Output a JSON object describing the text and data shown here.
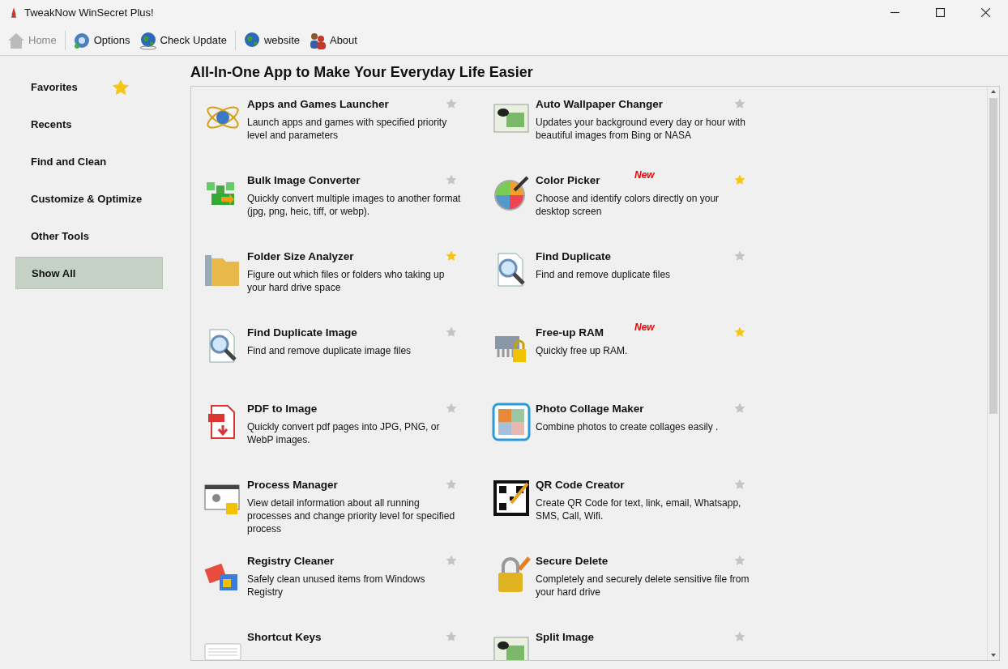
{
  "window": {
    "title": "TweakNow WinSecret Plus!"
  },
  "toolbar": [
    {
      "label": "Home",
      "disabled": true,
      "separator_after": true
    },
    {
      "label": "Options",
      "disabled": false,
      "separator_after": false
    },
    {
      "label": "Check Update",
      "disabled": false,
      "separator_after": true
    },
    {
      "label": "website",
      "disabled": false,
      "separator_after": false
    },
    {
      "label": "About",
      "disabled": false,
      "separator_after": false
    }
  ],
  "sidebar": {
    "items": [
      {
        "label": "Favorites",
        "selected": false,
        "star": true
      },
      {
        "label": "Recents",
        "selected": false,
        "star": false
      },
      {
        "label": "Find and Clean",
        "selected": false,
        "star": false
      },
      {
        "label": "Customize & Optimize",
        "selected": false,
        "star": false
      },
      {
        "label": "Other Tools",
        "selected": false,
        "star": false
      },
      {
        "label": "Show All",
        "selected": true,
        "star": false
      }
    ]
  },
  "heading": "All-In-One App to Make Your Everyday Life Easier",
  "tools": [
    {
      "title": "Apps and Games Launcher",
      "description": "Launch apps and games with specified priority level and parameters",
      "favorite": false
    },
    {
      "title": "Auto Wallpaper Changer",
      "description": "Updates your background every day or hour with beautiful images from Bing or NASA",
      "favorite": false
    },
    {
      "title": "Bulk Image Converter",
      "description": "Quickly convert multiple images to another format (jpg, png, heic, tiff, or webp).",
      "favorite": false
    },
    {
      "title": "Color Picker",
      "badge": "New",
      "description": "Choose and identify colors directly on your desktop screen",
      "favorite": true
    },
    {
      "title": "Folder Size Analyzer",
      "description": "Figure out which files or folders who taking up your hard drive space",
      "favorite": true
    },
    {
      "title": "Find Duplicate",
      "description": "Find and remove duplicate files",
      "favorite": false
    },
    {
      "title": "Find Duplicate Image",
      "description": "Find and remove duplicate image files",
      "favorite": false
    },
    {
      "title": "Free-up RAM",
      "badge": "New",
      "description": "Quickly free up RAM.",
      "favorite": true
    },
    {
      "title": "PDF to Image",
      "description": "Quickly convert pdf pages into JPG, PNG, or WebP images.",
      "favorite": false
    },
    {
      "title": "Photo Collage Maker",
      "description": "Combine photos to create collages easily .",
      "favorite": false
    },
    {
      "title": "Process Manager",
      "description": "View detail information about all running processes and change priority level for specified process",
      "favorite": false
    },
    {
      "title": "QR Code Creator",
      "description": "Create QR Code for text, link, email, Whatsapp, SMS, Call, Wifi.",
      "favorite": false
    },
    {
      "title": "Registry Cleaner",
      "description": "Safely clean unused items from Windows Registry",
      "favorite": false
    },
    {
      "title": "Secure Delete",
      "description": "Completely and securely delete sensitive file from your hard drive",
      "favorite": false
    },
    {
      "title": "Shortcut Keys",
      "favorite": false
    },
    {
      "title": "Split Image",
      "favorite": false
    }
  ]
}
